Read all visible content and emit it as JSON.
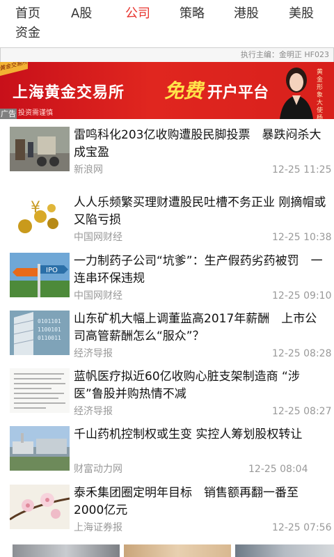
{
  "nav": {
    "tabs": [
      {
        "label": "首页"
      },
      {
        "label": "A股"
      },
      {
        "label": "公司"
      },
      {
        "label": "策略"
      },
      {
        "label": "港股"
      },
      {
        "label": "美股"
      },
      {
        "label": "资金"
      }
    ],
    "active_index": 2,
    "active_color": "#e8342e"
  },
  "editor_bar": {
    "text": "执行主编：金明正 HF023"
  },
  "banner": {
    "tag": "黄金交易所",
    "title": "上海黄金交易所",
    "free": "免费",
    "platform": "开户平台",
    "side_text": "黄金形象大使 杨"
  },
  "ad_badge": "广告",
  "banner_sub": "投资需谨慎",
  "news": [
    {
      "title": "雷鸣科化203亿收购遭股民脚投票　暴跌闷杀大成宝盈",
      "source": "新浪网",
      "time": "12-25 11:25",
      "thumb_icon": "street-vendor-image"
    },
    {
      "title": "人人乐频繁买理财遭股民吐槽不务正业 刚摘帽或又陷亏损",
      "source": "中国网财经",
      "time": "12-25 10:38",
      "thumb_icon": "gold-coins-image"
    },
    {
      "title": "一力制药子公司“坑爹”：生产假药劣药被罚　一连串环保违规",
      "source": "中国网财经",
      "time": "12-25 09:10",
      "thumb_icon": "ipo-signpost-image"
    },
    {
      "title": "山东矿机大幅上调董监高2017年薪酬　上市公司高管薪酬怎么“服众”？",
      "source": "经济导报",
      "time": "12-25 08:28",
      "thumb_icon": "building-binary-image"
    },
    {
      "title": "蓝帆医疗拟近60亿收购心脏支架制造商 “涉医”鲁股并购热情不减",
      "source": "经济导报",
      "time": "12-25 08:27",
      "thumb_icon": "document-image"
    },
    {
      "title": "千山药机控制权或生变 实控人筹划股权转让",
      "source": "财富动力网",
      "time": "12-25 08:04",
      "thumb_icon": "factory-image"
    },
    {
      "title": "泰禾集团圈定明年目标　销售额再翻一番至2000亿元",
      "source": "上海证券报",
      "time": "12-25 07:56",
      "thumb_icon": "flower-image"
    }
  ]
}
